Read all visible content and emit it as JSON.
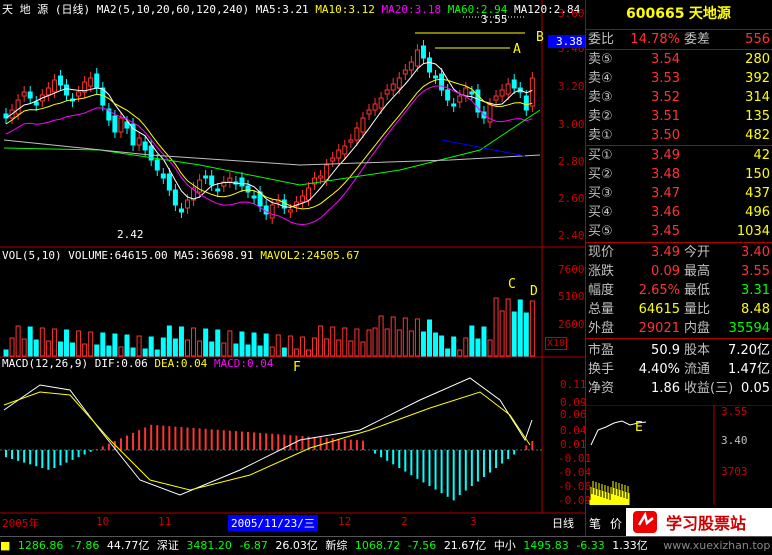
{
  "header": {
    "title": "天 地 源 (日线)",
    "ma_label": "MA2(5,10,20,60,120,240)",
    "ma5": "MA5:3.21",
    "ma10": "MA10:3.12",
    "ma20": "MA20:3.18",
    "ma60": "MA60:2.94",
    "ma120": "MA120:2.84"
  },
  "price_axis": [
    "3.60",
    "3.40",
    "3.20",
    "3.00",
    "2.80",
    "2.60",
    "2.40"
  ],
  "current_price_tag": "3.38",
  "annotations": {
    "high_price": "3.55",
    "low_price": "2.42",
    "A": "A",
    "B": "B",
    "C": "C",
    "D": "D",
    "E": "E",
    "F": "F"
  },
  "volume_panel": {
    "label": "VOL(5,10)",
    "volume": "VOLUME:64615.00",
    "ma5": "MA5:36698.91",
    "mavol2": "MAVOL2:24505.67",
    "axis": [
      "7600",
      "5100",
      "2600"
    ],
    "unit": "X10"
  },
  "macd_panel": {
    "label": "MACD(12,26,9)",
    "dif": "DIF:0.06",
    "dea": "DEA:0.04",
    "macd": "MACD:0.04",
    "axis": [
      "0.11",
      "0.09",
      "0.06",
      "0.04",
      "0.01",
      "-0.01",
      "-0.04",
      "-0.06",
      "-0.09"
    ]
  },
  "x_axis": {
    "labels": [
      "2005年",
      "10",
      "11",
      "12",
      "2",
      "3"
    ],
    "cursor_date": "2005/11/23/三",
    "period": "日线"
  },
  "side": {
    "code": "600665",
    "name": "天地源",
    "weibi_label": "委比",
    "weibi": "14.78%",
    "weicha_label": "委差",
    "weicha": "556",
    "asks": [
      {
        "label": "卖⑤",
        "price": "3.54",
        "vol": "280"
      },
      {
        "label": "卖④",
        "price": "3.53",
        "vol": "392"
      },
      {
        "label": "卖③",
        "price": "3.52",
        "vol": "314"
      },
      {
        "label": "卖②",
        "price": "3.51",
        "vol": "135"
      },
      {
        "label": "卖①",
        "price": "3.50",
        "vol": "482"
      }
    ],
    "bids": [
      {
        "label": "买①",
        "price": "3.49",
        "vol": "42"
      },
      {
        "label": "买②",
        "price": "3.48",
        "vol": "150"
      },
      {
        "label": "买③",
        "price": "3.47",
        "vol": "437"
      },
      {
        "label": "买④",
        "price": "3.46",
        "vol": "496"
      },
      {
        "label": "买⑤",
        "price": "3.45",
        "vol": "1034"
      }
    ],
    "stats": [
      {
        "l1": "现价",
        "v1": "3.49",
        "l2": "今开",
        "v2": "3.40"
      },
      {
        "l1": "涨跌",
        "v1": "0.09",
        "l2": "最高",
        "v2": "3.55"
      },
      {
        "l1": "幅度",
        "v1": "2.65%",
        "l2": "最低",
        "v2": "3.31"
      },
      {
        "l1": "总量",
        "v1": "64615",
        "l2": "量比",
        "v2": "8.48"
      },
      {
        "l1": "外盘",
        "v1": "29021",
        "l2": "内盘",
        "v2": "35594"
      }
    ],
    "stats2": [
      {
        "l1": "市盈",
        "v1": "50.9",
        "l2": "股本",
        "v2": "7.20亿"
      },
      {
        "l1": "换手",
        "v1": "4.40%",
        "l2": "流通",
        "v2": "1.47亿"
      },
      {
        "l1": "净资",
        "v1": "1.86",
        "l2": "收益(三)",
        "v2": "0.05"
      }
    ],
    "mini_axis": [
      "3.55",
      "3.40",
      "3703"
    ],
    "tabs": [
      "笔",
      "价"
    ]
  },
  "ticker": [
    {
      "v": "1286.86",
      "c": "-7.86",
      "a": "44.77亿"
    },
    {
      "n": "深证",
      "v": "3481.20",
      "c": "-6.87",
      "a": "26.03亿"
    },
    {
      "n": "新综",
      "v": "1068.72",
      "c": "-7.56",
      "a": "21.67亿"
    },
    {
      "n": "中小",
      "v": "1495.83",
      "c": "-6.33",
      "a": "1.33亿"
    }
  ],
  "brand": {
    "name": "学习股票站",
    "url": "www.xuexizhan.top"
  },
  "colors": {
    "up": "#ff3333",
    "down": "#00ffff",
    "ma5": "#ffffff",
    "ma10": "#ffff00",
    "ma20": "#ff00ff",
    "ma60": "#00ff00",
    "ma120": "#ffffff"
  }
}
